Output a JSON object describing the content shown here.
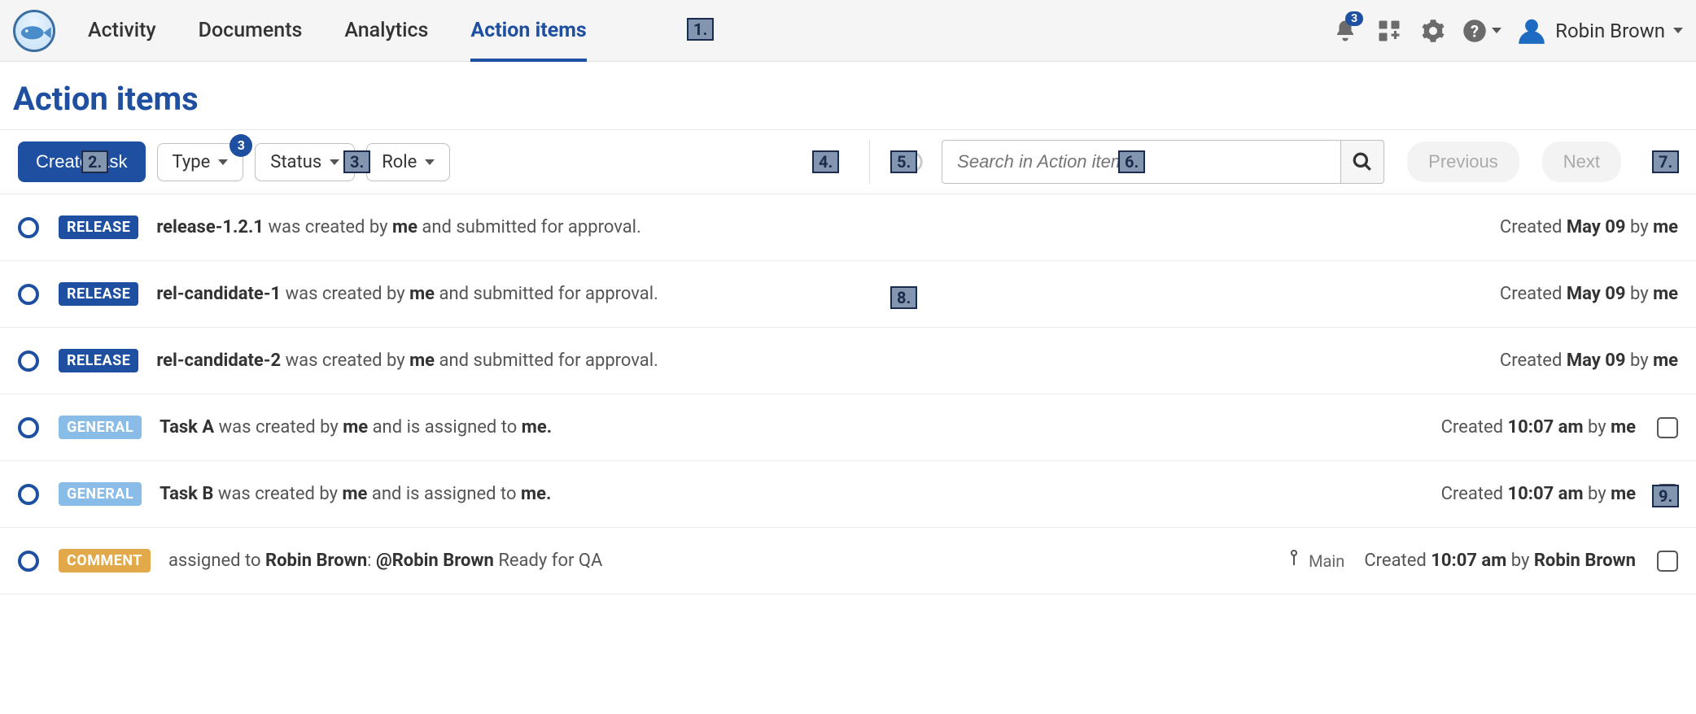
{
  "nav": {
    "tabs": [
      "Activity",
      "Documents",
      "Analytics",
      "Action items"
    ],
    "active_index": 3
  },
  "notification_count": "3",
  "user": {
    "name": "Robin Brown"
  },
  "page_title": "Action items",
  "toolbar": {
    "create_label": "Create task",
    "type_label": "Type",
    "type_badge": "3",
    "status_label": "Status",
    "role_label": "Role",
    "search_placeholder": "Search in Action items",
    "previous_label": "Previous",
    "next_label": "Next"
  },
  "items": [
    {
      "badge": "RELEASE",
      "badge_class": "release",
      "title": "release-1.2.1",
      "text_mid": " was created by ",
      "actor": "me",
      "text_tail": " and submitted for approval.",
      "created_label": "Created ",
      "created_value": "May 09",
      "by_label": " by ",
      "by_value": "me",
      "has_checkbox": false,
      "has_branch": false
    },
    {
      "badge": "RELEASE",
      "badge_class": "release",
      "title": "rel-candidate-1",
      "text_mid": " was created by ",
      "actor": "me",
      "text_tail": " and submitted for approval.",
      "created_label": "Created ",
      "created_value": "May 09",
      "by_label": " by ",
      "by_value": "me",
      "has_checkbox": false,
      "has_branch": false
    },
    {
      "badge": "RELEASE",
      "badge_class": "release",
      "title": "rel-candidate-2",
      "text_mid": " was created by ",
      "actor": "me",
      "text_tail": " and submitted for approval.",
      "created_label": "Created ",
      "created_value": "May 09",
      "by_label": " by ",
      "by_value": "me",
      "has_checkbox": false,
      "has_branch": false
    },
    {
      "badge": "GENERAL",
      "badge_class": "general",
      "title": "Task A",
      "text_mid": " was created by ",
      "actor": "me",
      "text_tail_pre": " and is assigned to ",
      "assignee": "me.",
      "created_label": "Created ",
      "created_value": "10:07 am",
      "by_label": " by ",
      "by_value": "me",
      "has_checkbox": true,
      "has_branch": false
    },
    {
      "badge": "GENERAL",
      "badge_class": "general",
      "title": "Task B",
      "text_mid": " was created by ",
      "actor": "me",
      "text_tail_pre": " and is assigned to ",
      "assignee": "me.",
      "created_label": "Created ",
      "created_value": "10:07 am",
      "by_label": " by ",
      "by_value": "me",
      "has_checkbox": true,
      "has_branch": false
    },
    {
      "badge": "COMMENT",
      "badge_class": "comment",
      "comment_prefix": "assigned to ",
      "comment_user": "Robin Brown",
      "comment_sep": ":   ",
      "comment_mention": "@Robin Brown",
      "comment_tail": " Ready for QA",
      "branch_label": "Main",
      "created_label": "Created ",
      "created_value": "10:07 am",
      "by_label": " by ",
      "by_value": "Robin Brown",
      "has_checkbox": true,
      "has_branch": true
    }
  ],
  "markers": {
    "1": "1.",
    "2": "2.",
    "3": "3.",
    "4": "4.",
    "5": "5.",
    "6": "6.",
    "7": "7.",
    "8": "8.",
    "9": "9."
  }
}
